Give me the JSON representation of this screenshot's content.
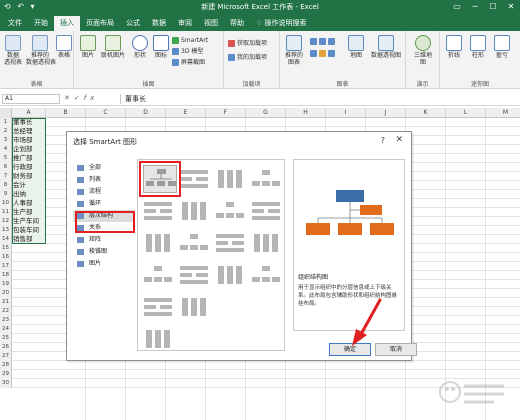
{
  "titlebar": {
    "title": "新建 Microsoft Excel 工作表 - Excel",
    "quick_access": "⟲ ↶ ▾"
  },
  "tabs": [
    {
      "label": "文件",
      "active": false
    },
    {
      "label": "开始",
      "active": false
    },
    {
      "label": "插入",
      "active": true
    },
    {
      "label": "页面布局",
      "active": false
    },
    {
      "label": "公式",
      "active": false
    },
    {
      "label": "数据",
      "active": false
    },
    {
      "label": "审阅",
      "active": false
    },
    {
      "label": "视图",
      "active": false
    },
    {
      "label": "帮助",
      "active": false
    }
  ],
  "tell_me": "操作说明搜索",
  "ribbon": {
    "groups": {
      "tables": "表格",
      "illustrations": "插图",
      "addins": "加载项",
      "charts": "图表",
      "tours": "演示",
      "sparklines": "迷你图"
    },
    "buttons": {
      "pivot_table": "数据\n透视表",
      "recommended_pivot": "推荐的\n数据透视表",
      "table": "表格",
      "pictures": "图片",
      "online_pictures": "联机图片",
      "shapes": "形状",
      "icons": "图标",
      "smartart": "SmartArt",
      "model3d": "3D 模型",
      "screenshot": "屏幕截图",
      "get_addins": "获取加载项",
      "my_addins": "我的加载项",
      "recommended_charts": "推荐的\n图表",
      "maps": "地图",
      "pivot_chart": "数据透视图",
      "map3d": "三维地\n图",
      "line": "折线",
      "column": "柱形",
      "winloss": "盈亏"
    }
  },
  "formula_bar": {
    "name_box": "A1",
    "content": "董事长"
  },
  "columns": [
    "A",
    "B",
    "C",
    "D",
    "E",
    "F",
    "G",
    "H",
    "I",
    "J",
    "K",
    "L",
    "M"
  ],
  "cells": [
    {
      "row": "1",
      "value": "董事长"
    },
    {
      "row": "2",
      "value": "总经理"
    },
    {
      "row": "3",
      "value": "市场部"
    },
    {
      "row": "4",
      "value": "企划部"
    },
    {
      "row": "5",
      "value": "推广部"
    },
    {
      "row": "6",
      "value": "行政部"
    },
    {
      "row": "7",
      "value": "财务部"
    },
    {
      "row": "8",
      "value": "会计"
    },
    {
      "row": "9",
      "value": "出纳"
    },
    {
      "row": "10",
      "value": "人事部"
    },
    {
      "row": "11",
      "value": "生产部"
    },
    {
      "row": "12",
      "value": "生产车间"
    },
    {
      "row": "13",
      "value": "包装车间"
    },
    {
      "row": "14",
      "value": "销售部"
    },
    {
      "row": "15",
      "value": ""
    },
    {
      "row": "16",
      "value": ""
    },
    {
      "row": "17",
      "value": ""
    },
    {
      "row": "18",
      "value": ""
    },
    {
      "row": "19",
      "value": ""
    },
    {
      "row": "20",
      "value": ""
    },
    {
      "row": "21",
      "value": ""
    },
    {
      "row": "22",
      "value": ""
    },
    {
      "row": "23",
      "value": ""
    },
    {
      "row": "24",
      "value": ""
    },
    {
      "row": "25",
      "value": ""
    },
    {
      "row": "26",
      "value": ""
    },
    {
      "row": "27",
      "value": ""
    },
    {
      "row": "28",
      "value": ""
    },
    {
      "row": "29",
      "value": ""
    },
    {
      "row": "30",
      "value": ""
    }
  ],
  "dialog": {
    "title": "选择 SmartArt 图形",
    "help": "?",
    "close": "✕",
    "categories": [
      {
        "label": "全部",
        "icon": "all-icon"
      },
      {
        "label": "列表",
        "icon": "list-icon"
      },
      {
        "label": "流程",
        "icon": "process-icon"
      },
      {
        "label": "循环",
        "icon": "cycle-icon"
      },
      {
        "label": "层次结构",
        "icon": "hierarchy-icon",
        "active": true
      },
      {
        "label": "关系",
        "icon": "relationship-icon"
      },
      {
        "label": "矩阵",
        "icon": "matrix-icon"
      },
      {
        "label": "棱锥图",
        "icon": "pyramid-icon"
      },
      {
        "label": "图片",
        "icon": "picture-icon"
      }
    ],
    "preview_name": "组织结构图",
    "preview_description": "用于显示组织中的分层信息或上下级关系。此布局包含辅助形状和组织结构图悬挂布局。",
    "ok_label": "确定",
    "cancel_label": "取消"
  },
  "colors": {
    "excel_green": "#217346",
    "highlight_red": "#e02020",
    "preview_orange": "#e36c1c",
    "preview_blue": "#3d6ea8"
  }
}
